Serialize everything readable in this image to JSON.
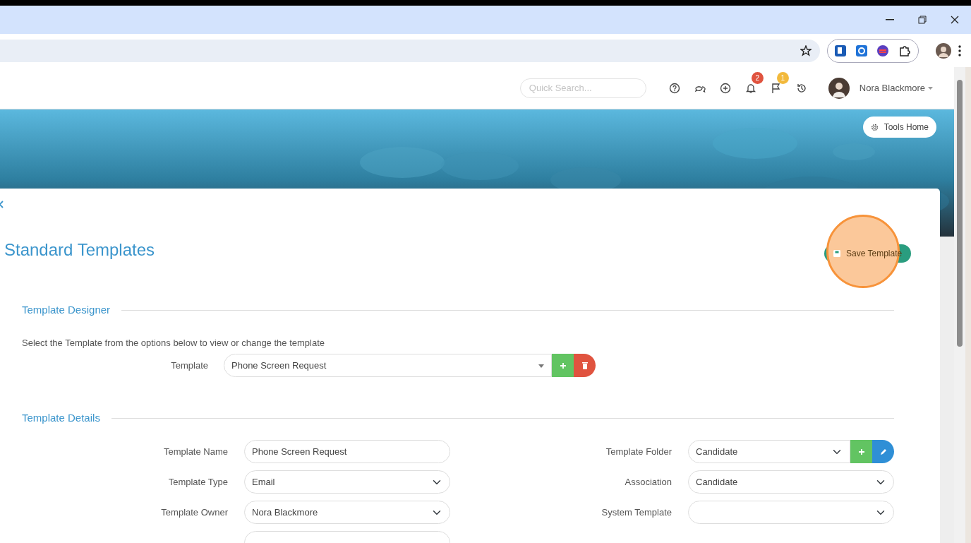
{
  "header": {
    "search": {
      "placeholder": "Quick Search..."
    },
    "icons": [
      {
        "kind": "help"
      },
      {
        "kind": "chat"
      },
      {
        "kind": "add"
      },
      {
        "kind": "bell",
        "badge": "2",
        "color": "#e0533f"
      },
      {
        "kind": "flag",
        "badge": "1",
        "color": "#f2b93b"
      },
      {
        "kind": "history"
      }
    ],
    "user": {
      "name": "Nora Blackmore"
    }
  },
  "banner": {
    "tools_home_button": "Tools Home"
  },
  "page": {
    "title": "Standard Templates",
    "save_button": {
      "label": "Save Template",
      "highlighted": true
    }
  },
  "template_designer": {
    "title": "Template Designer",
    "instruction": "Select the Template from the options below to view or change the template",
    "template": {
      "label": "Template",
      "value": "Phone Screen Request"
    }
  },
  "template_details": {
    "title": "Template Details",
    "left": [
      {
        "kind": "text",
        "label": "Template Name",
        "value": "Phone Screen Request"
      },
      {
        "kind": "select",
        "label": "Template Type",
        "value": "Email"
      },
      {
        "kind": "select",
        "label": "Template Owner",
        "value": "Nora Blackmore"
      },
      {
        "kind": "text"
      }
    ],
    "right": [
      {
        "kind": "folder",
        "label": "Template Folder",
        "value": "Candidate"
      },
      {
        "kind": "select",
        "label": "Association",
        "value": "Candidate"
      },
      {
        "kind": "select",
        "label": "System Template"
      }
    ]
  }
}
